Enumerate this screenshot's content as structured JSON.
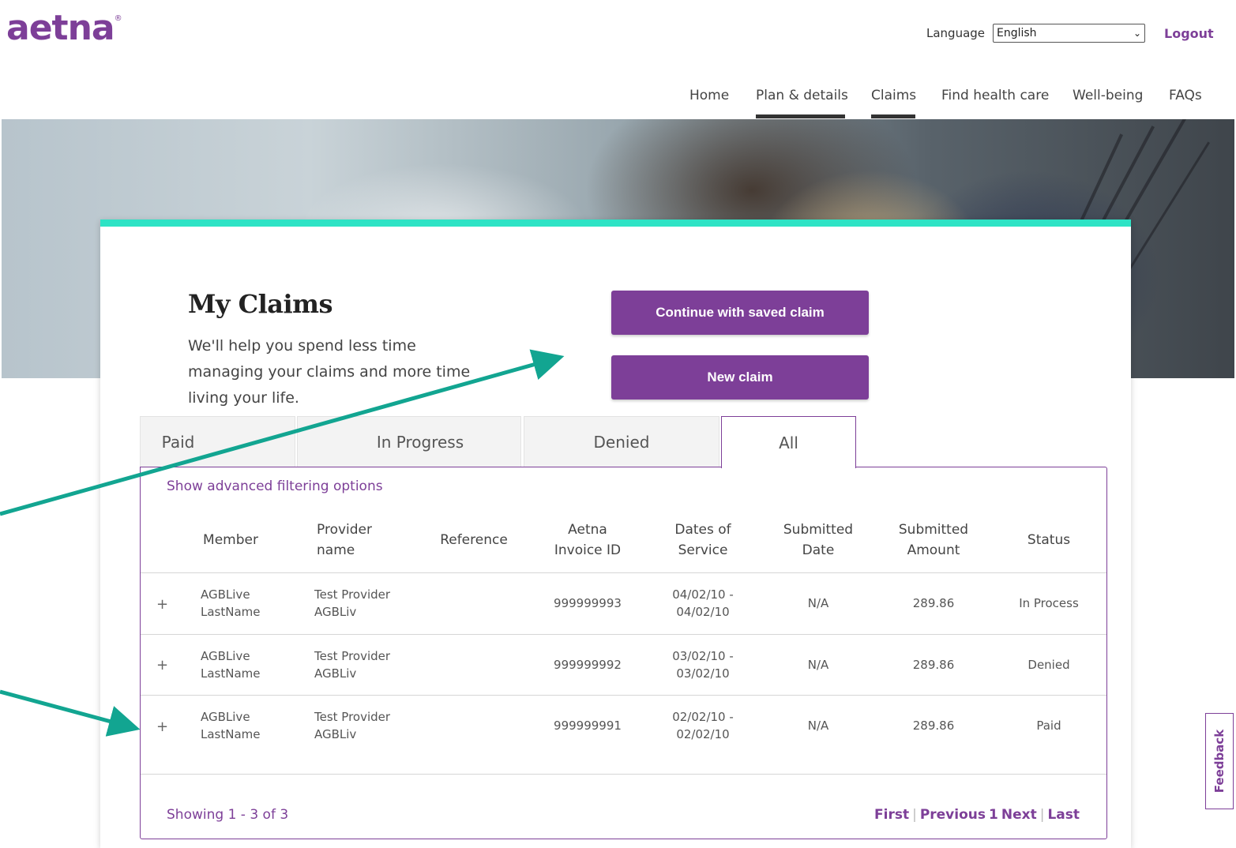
{
  "header": {
    "logo_text": "aetna",
    "logo_mark": "®",
    "language_label": "Language",
    "language_value": "English",
    "logout_label": "Logout"
  },
  "nav": {
    "items": [
      "Home",
      "Plan & details",
      "Claims",
      "Find health care",
      "Well-being",
      "FAQs"
    ]
  },
  "page": {
    "title": "My Claims",
    "subtitle": "We'll help you spend less time managing your claims and more time living your life.",
    "continue_button": "Continue with saved claim",
    "new_claim_button": "New claim"
  },
  "tabs": [
    {
      "label": "Paid",
      "active": false
    },
    {
      "label": "In Progress",
      "active": false
    },
    {
      "label": "Denied",
      "active": false
    },
    {
      "label": "All",
      "active": true
    }
  ],
  "table": {
    "advanced_filter_link": "Show advanced filtering options",
    "headers": {
      "member": "Member",
      "provider": "Provider name",
      "reference": "Reference",
      "invoice": "Aetna Invoice ID",
      "dates": "Dates of Service",
      "submitted_date": "Submitted Date",
      "submitted_amount": "Submitted Amount",
      "status": "Status"
    },
    "rows": [
      {
        "expand": "+",
        "member": "AGBLive LastName",
        "provider": "Test Provider AGBLiv",
        "reference": "",
        "invoice": "999999993",
        "dates": "04/02/10 - 04/02/10",
        "submitted_date": "N/A",
        "amount": "289.86",
        "status": "In Process"
      },
      {
        "expand": "+",
        "member": "AGBLive LastName",
        "provider": "Test Provider AGBLiv",
        "reference": "",
        "invoice": "999999992",
        "dates": "03/02/10 - 03/02/10",
        "submitted_date": "N/A",
        "amount": "289.86",
        "status": "Denied"
      },
      {
        "expand": "+",
        "member": "AGBLive LastName",
        "provider": "Test Provider AGBLiv",
        "reference": "",
        "invoice": "999999991",
        "dates": "02/02/10 - 02/02/10",
        "submitted_date": "N/A",
        "amount": "289.86",
        "status": "Paid"
      }
    ],
    "showing_text": "Showing 1 - 3 of 3",
    "pagination": {
      "first": "First",
      "previous": "Previous",
      "current_page": "1",
      "next": "Next",
      "last": "Last"
    }
  },
  "feedback_label": "Feedback",
  "colors": {
    "brand_purple": "#7d3f98",
    "accent_teal": "#2ee3c5",
    "annotation_arrow": "#12a591"
  }
}
